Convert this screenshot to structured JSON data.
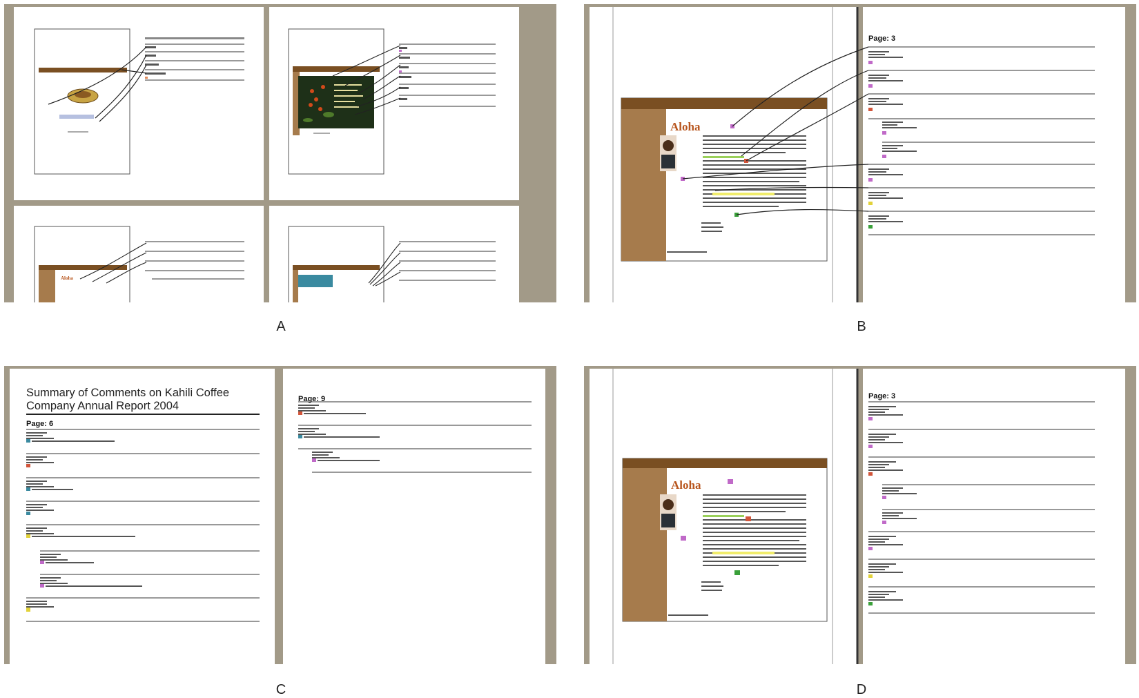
{
  "captions": {
    "a": "A",
    "b": "B",
    "c": "C",
    "d": "D"
  },
  "panel_c": {
    "summary_title": "Summary of Comments on Kahili Coffee Company Annual Report 2004",
    "left_page_label": "Page: 6",
    "right_page_label": "Page: 9"
  },
  "panel_b": {
    "page_label": "Page: 3",
    "doc_heading": "Aloha"
  },
  "panel_d": {
    "page_label": "Page: 3",
    "doc_heading": "Aloha"
  },
  "colors": {
    "frame": "#a29a88",
    "page": "#ffffff",
    "brown_band": "#7a4f22",
    "tan_sidebar": "#a67b4c",
    "aloha_text": "#b8561e",
    "note_pink": "#c06ac8",
    "note_green": "#3aa03a",
    "note_red": "#d2553a",
    "note_yellow": "#e2d23a"
  },
  "icons": [
    "comment-note-icon",
    "connector-line",
    "coffee-photo",
    "portrait-photo"
  ]
}
